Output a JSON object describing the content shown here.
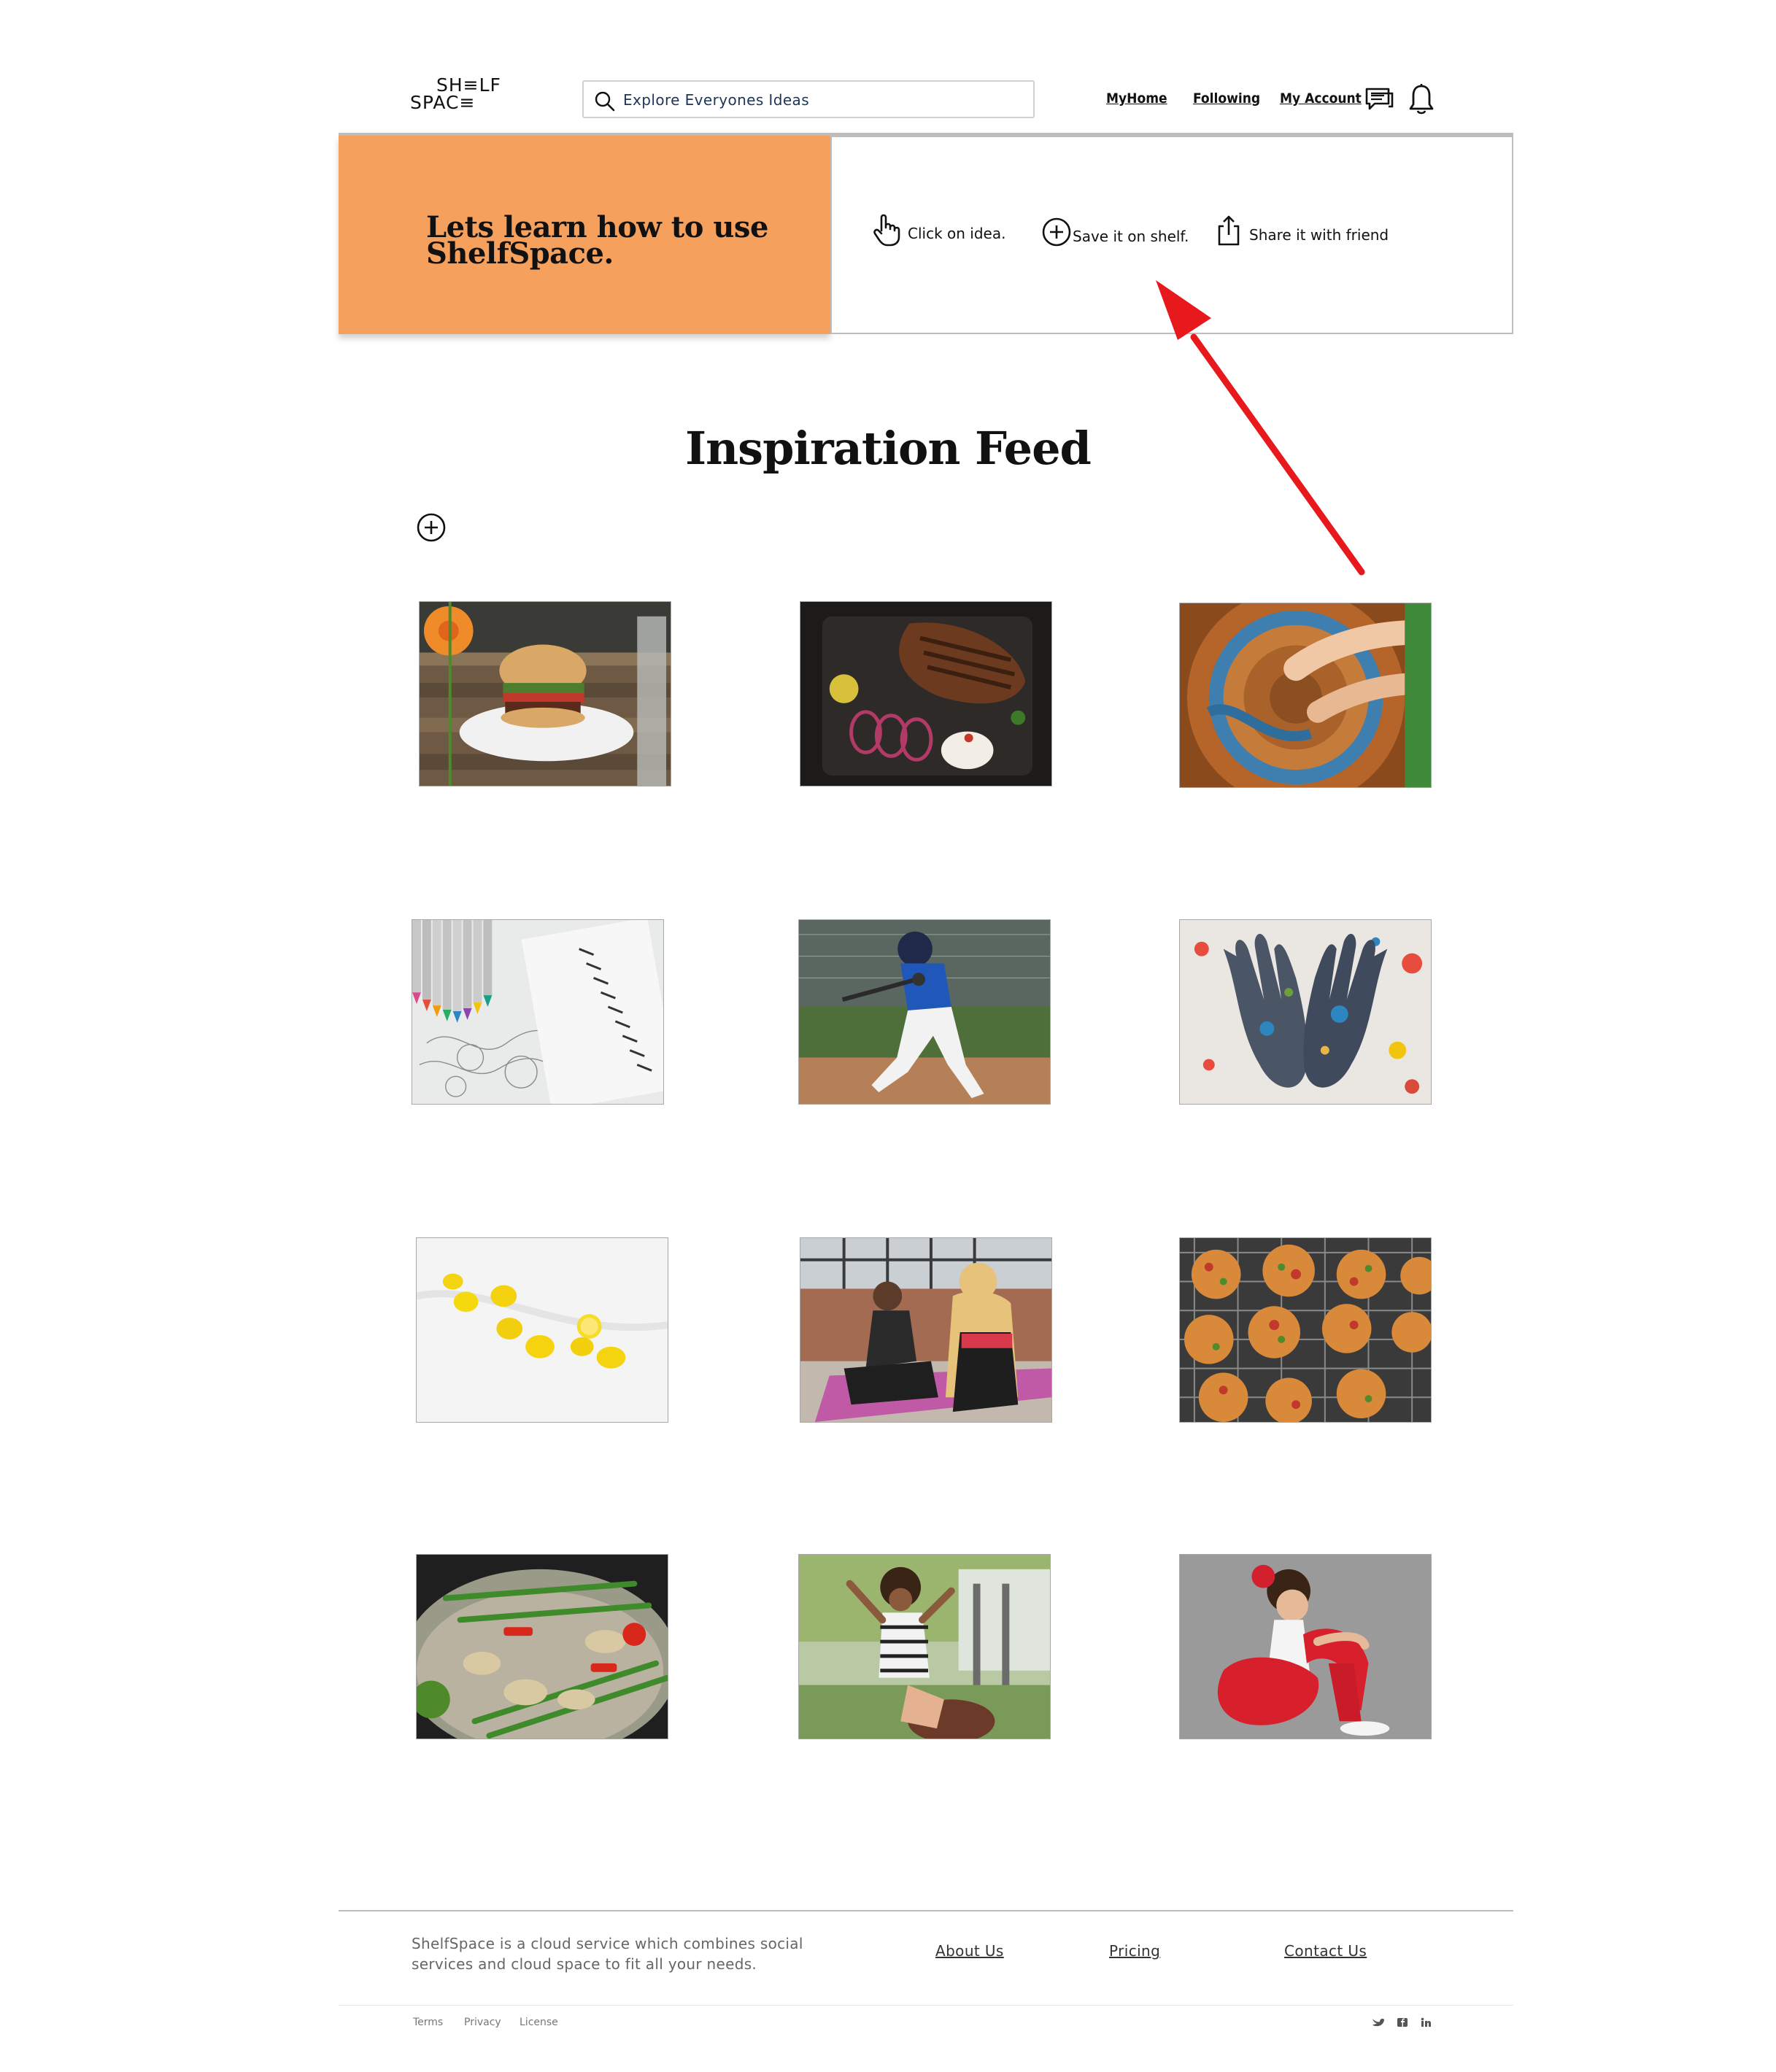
{
  "header": {
    "logo_top": "SH≡LF",
    "logo_bottom": "SPAC≡",
    "search_placeholder": "Explore Everyones Ideas",
    "nav": [
      "MyHome",
      "Following",
      "My Account"
    ]
  },
  "tutorial": {
    "title": "Lets learn how to use ShelfSpace.",
    "steps": [
      "Click on idea.",
      "Save it on shelf.",
      "Share it with friend"
    ],
    "accent_color": "#f6a05e"
  },
  "feed": {
    "title": "Inspiration Feed",
    "items": [
      {
        "subject": "burger"
      },
      {
        "subject": "ribs-platter"
      },
      {
        "subject": "pottery-wheel"
      },
      {
        "subject": "colored-pencils-notebook"
      },
      {
        "subject": "baseball-batter"
      },
      {
        "subject": "painted-hands"
      },
      {
        "subject": "lemons"
      },
      {
        "subject": "yoga-class"
      },
      {
        "subject": "mini-pizzas"
      },
      {
        "subject": "vegetable-stir-fry"
      },
      {
        "subject": "child-playing"
      },
      {
        "subject": "ballet-girl"
      }
    ]
  },
  "annotation": {
    "arrow_color": "#e8191c"
  },
  "footer": {
    "description": "ShelfSpace is a cloud service which combines social services and cloud space to fit all your needs.",
    "links": [
      "About Us",
      "Pricing",
      "Contact Us"
    ],
    "legal": [
      "Terms",
      "Privacy",
      "License"
    ],
    "social": [
      "twitter-icon",
      "facebook-icon",
      "linkedin-icon"
    ]
  }
}
